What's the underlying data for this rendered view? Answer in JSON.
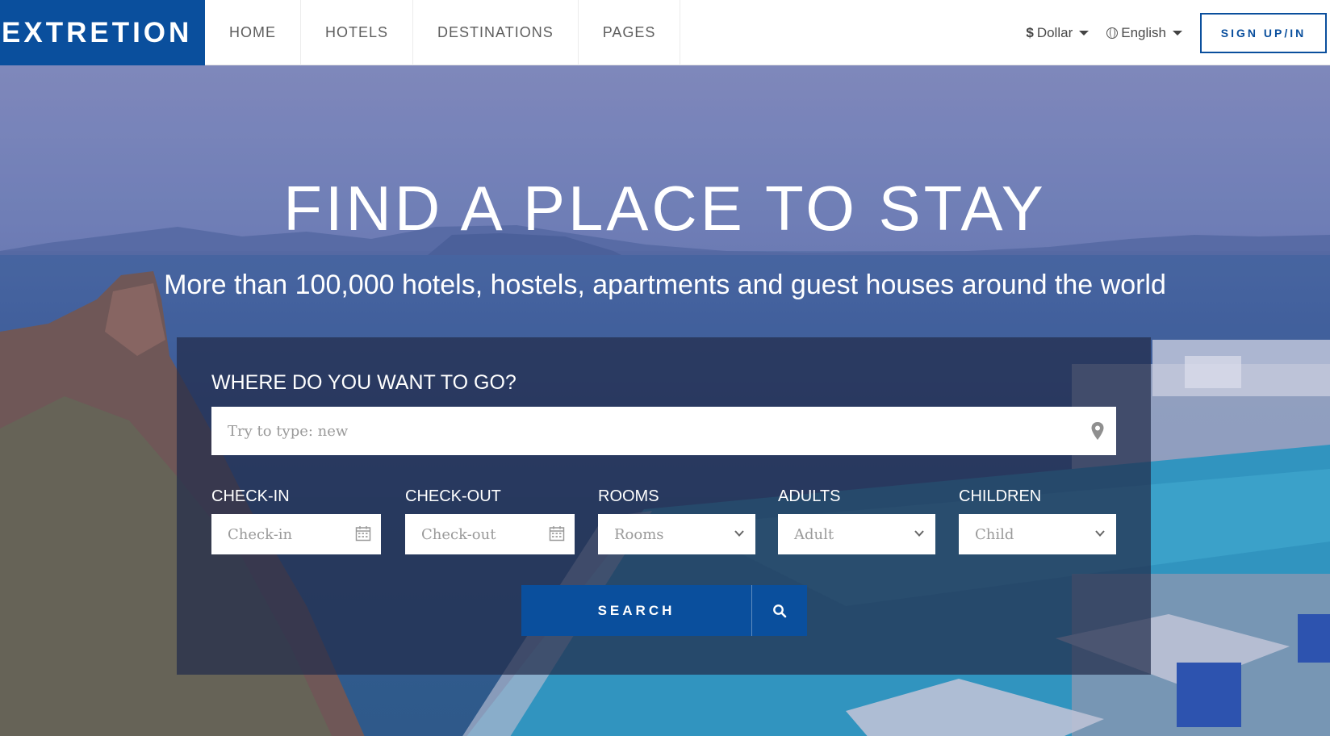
{
  "brand": {
    "logo": "EXTRETION",
    "primary_color": "#0a4f9d"
  },
  "nav": {
    "items": [
      {
        "label": "HOME"
      },
      {
        "label": "HOTELS"
      },
      {
        "label": "DESTINATIONS"
      },
      {
        "label": "PAGES"
      }
    ]
  },
  "header": {
    "currency": {
      "symbol": "$",
      "label": "Dollar"
    },
    "language": {
      "label": "English"
    },
    "signup_label": "SIGN UP/IN"
  },
  "hero": {
    "title": "FIND A PLACE TO STAY",
    "subtitle": "More than 100,000 hotels, hostels, apartments and guest houses around the world"
  },
  "search": {
    "heading": "WHERE DO YOU WANT TO GO?",
    "destination_placeholder": "Try to type: new",
    "checkin": {
      "label": "CHECK-IN",
      "placeholder": "Check-in"
    },
    "checkout": {
      "label": "CHECK-OUT",
      "placeholder": "Check-out"
    },
    "rooms": {
      "label": "ROOMS",
      "placeholder": "Rooms"
    },
    "adults": {
      "label": "ADULTS",
      "placeholder": "Adult"
    },
    "children": {
      "label": "CHILDREN",
      "placeholder": "Child"
    },
    "button_label": "SEARCH"
  }
}
